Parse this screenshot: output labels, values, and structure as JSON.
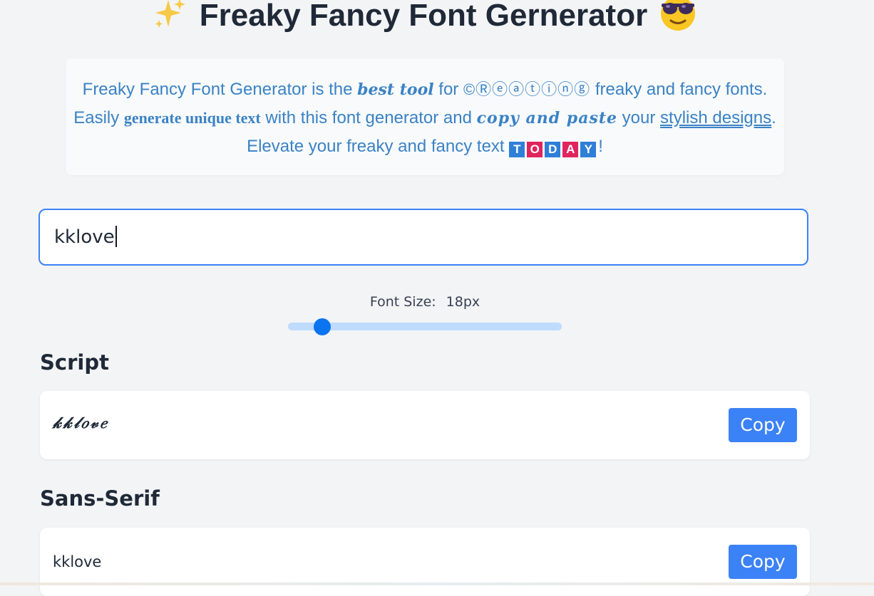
{
  "header": {
    "title": "Freaky Fancy Font Gernerator"
  },
  "intro": {
    "segments": {
      "s1": "Freaky Fancy Font Generator is the ",
      "s2": "best tool",
      "s3": " for ",
      "s4": "©Ⓡⓔⓐⓣⓘⓝⓖ",
      "s5": " freaky and fancy fonts. Easily ",
      "s6": "generate unique text",
      "s7": " with this font generator and ",
      "s8": "copy and paste",
      "s9": " your ",
      "s10": "stylish designs",
      "s11": ". Elevate your freaky and fancy text ",
      "s12": "!"
    },
    "today_letters": [
      "T",
      "O",
      "D",
      "A",
      "Y"
    ],
    "today_colors": [
      "#2f7fd8",
      "#e0245e",
      "#2f7fd8",
      "#e0245e",
      "#2f7fd8"
    ]
  },
  "search": {
    "value": "kklove"
  },
  "font_size": {
    "label": "Font Size:",
    "value": "18px",
    "level": 0.125
  },
  "sections": [
    {
      "heading": "Script",
      "sample": "𝓀𝓀𝓁𝑜𝓋𝑒",
      "copy_label": "Copy"
    },
    {
      "heading": "Sans-Serif",
      "sample": "kklove",
      "copy_label": "Copy"
    }
  ],
  "colors": {
    "accent": "#3b82f6",
    "intro_text": "#3b82c4",
    "slider_thumb": "#0b74f0",
    "slider_track": "#bfdbfe",
    "page_bg": "#f3f4f6"
  },
  "icons": {
    "left": "sparkles-icon",
    "right": "sunglasses-face-icon"
  }
}
